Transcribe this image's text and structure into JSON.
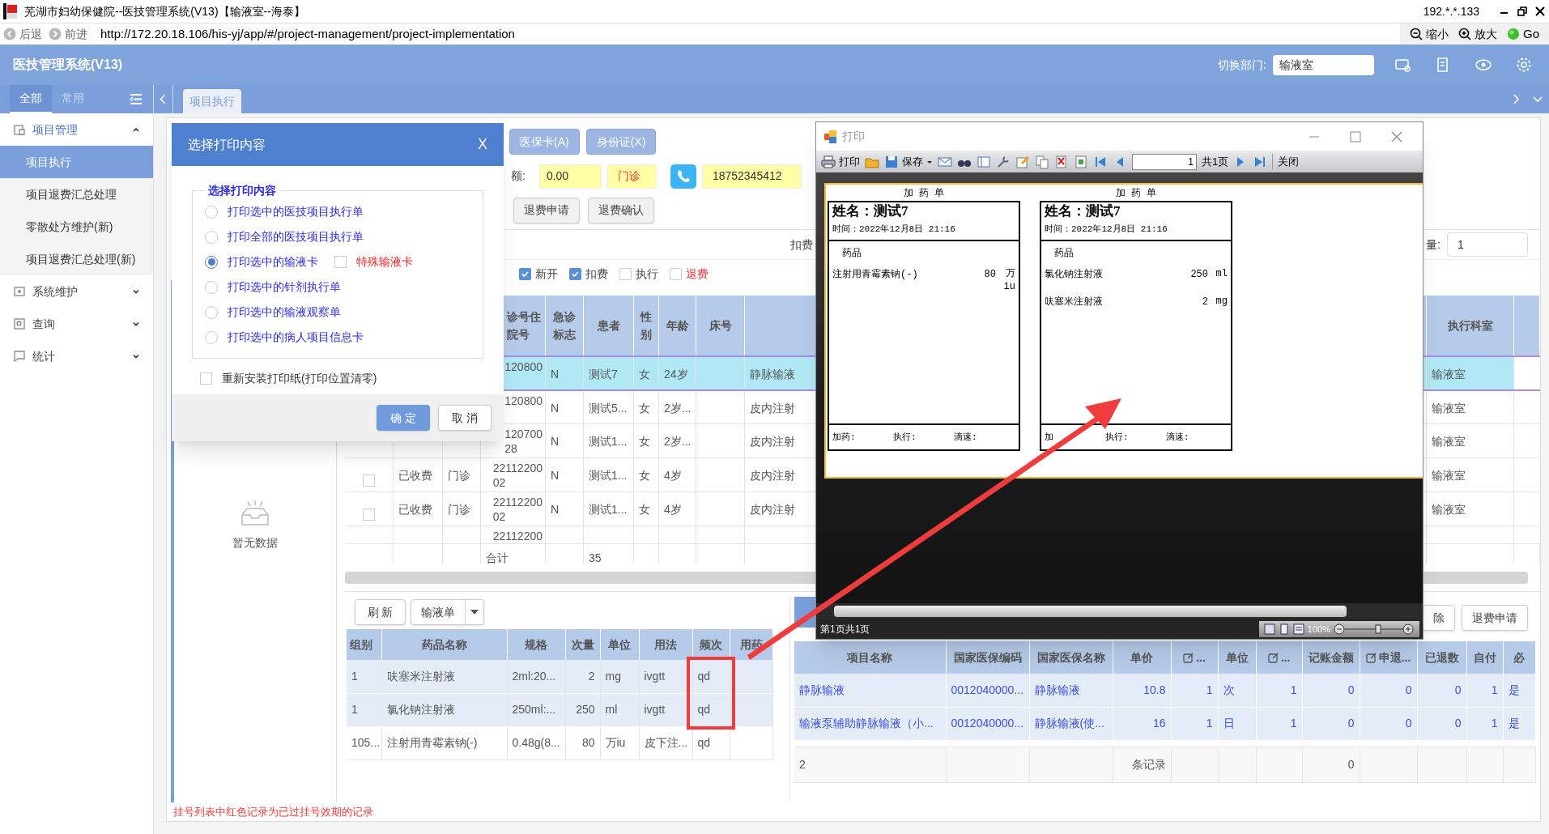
{
  "title_bar": {
    "title": "芜湖市妇幼保健院--医技管理系统(V13)【输液室--海泰】",
    "ip": "192.*.*.133"
  },
  "address_bar": {
    "back": "后退",
    "forward": "前进",
    "url": "http://172.20.18.106/his-yj/app/#/project-management/project-implementation",
    "zoom_out": "缩小",
    "zoom_in": "放大",
    "go": "Go"
  },
  "header": {
    "app_name": "医技管理系统(V13)",
    "dept_label": "切换部门:",
    "dept_value": "输液室"
  },
  "sidebar": {
    "tabs": [
      {
        "label": "全部",
        "selected": true
      },
      {
        "label": "常用",
        "selected": false
      }
    ],
    "items": [
      {
        "label": "项目管理",
        "expanded": true,
        "children": [
          {
            "label": "项目执行",
            "selected": true
          },
          {
            "label": "项目退费汇总处理",
            "selected": false
          },
          {
            "label": "零散处方维护(新)",
            "selected": false
          },
          {
            "label": "项目退费汇总处理(新)",
            "selected": false
          }
        ]
      },
      {
        "label": "系统维护",
        "expanded": false
      },
      {
        "label": "查询",
        "expanded": false
      },
      {
        "label": "统计",
        "expanded": false
      }
    ]
  },
  "tabs": [
    {
      "label": "项目执行",
      "selected": true
    }
  ],
  "toolbar": {
    "card_buttons": [
      "医保卡(A)",
      "身份证(X)"
    ],
    "balance_label": "额:",
    "balance": "0.00",
    "visit_type": "门诊",
    "phone": "18752345412",
    "refund_buttons": [
      "退费申请",
      "退费确认"
    ],
    "deduct_label": "扣费",
    "qty_label": "量:",
    "qty": "1",
    "filters": [
      {
        "label": "新开",
        "checked": true,
        "kind": "normal"
      },
      {
        "label": "扣费",
        "checked": true,
        "kind": "normal"
      },
      {
        "label": "执行",
        "checked": false,
        "kind": "normal"
      },
      {
        "label": "退费",
        "checked": false,
        "kind": "warning"
      }
    ]
  },
  "patient_table": {
    "columns": {
      "visit_no": "诊号住院号",
      "emergency": "急诊标志",
      "patient": "患者",
      "sex": "性别",
      "age": "年龄",
      "bed": "床号",
      "dept": "执行科室"
    },
    "rows": [
      {
        "visit_no": "120800",
        "emergency": "N",
        "patient": "测试7",
        "sex": "女",
        "age": "24岁",
        "diagnosis": "静脉输液",
        "dept": "输液室",
        "selected": true
      },
      {
        "visit_no": "120800",
        "emergency": "N",
        "patient": "测试5...",
        "sex": "女",
        "age": "2岁...",
        "diagnosis": "皮内注射",
        "dept": "输液室",
        "selected": false
      },
      {
        "visit_no": "120700\n28",
        "emergency": "N",
        "patient": "测试1...",
        "sex": "女",
        "age": "2岁...",
        "diagnosis": "皮内注射",
        "dept": "输液室",
        "selected": false
      },
      {
        "checked": false,
        "status": "已收费",
        "type": "门诊",
        "visit_no": "22112200\n02",
        "emergency": "N",
        "patient": "测试1...",
        "sex": "女",
        "age": "4岁",
        "diagnosis": "皮内注射",
        "dept": "输液室",
        "selected": false
      },
      {
        "checked": false,
        "status": "已收费",
        "type": "门诊",
        "visit_no": "22112200\n02",
        "emergency": "N",
        "patient": "测试1...",
        "sex": "女",
        "age": "4岁",
        "diagnosis": "皮内注射",
        "dept": "输液室",
        "selected": false
      },
      {
        "visit_no": "22112200",
        "selected": false
      }
    ],
    "footer": {
      "label": "合计",
      "count": "35"
    }
  },
  "patient_list": {
    "empty_text": "暂无数据"
  },
  "drug_panel": {
    "buttons": [
      "刷 新",
      "输液单"
    ],
    "columns": [
      "组别",
      "药品名称",
      "规格",
      "次量",
      "单位",
      "用法",
      "频次",
      "用药"
    ],
    "rows": [
      [
        "1",
        "呋塞米注射液",
        "2ml:20...",
        "2",
        "mg",
        "ivgtt",
        "qd"
      ],
      [
        "1",
        "氯化钠注射液",
        "250ml:...",
        "250",
        "ml",
        "ivgtt",
        "qd"
      ],
      [
        "105...",
        "注射用青霉素钠(-)",
        "0.48g(8...",
        "80",
        "万iu",
        "皮下注...",
        "qd"
      ]
    ]
  },
  "item_panel": {
    "buttons": [
      "除",
      "退费申请"
    ],
    "columns": [
      {
        "label": "项目名称",
        "editable": false
      },
      {
        "label": "国家医保编码",
        "editable": false
      },
      {
        "label": "国家医保名称",
        "editable": false
      },
      {
        "label": "单价",
        "editable": false
      },
      {
        "label": "...",
        "editable": true
      },
      {
        "label": "单位",
        "editable": false
      },
      {
        "label": "...",
        "editable": true
      },
      {
        "label": "记账金额",
        "editable": false
      },
      {
        "label": "申退...",
        "editable": true
      },
      {
        "label": "已退数",
        "editable": false
      },
      {
        "label": "自付",
        "editable": false
      },
      {
        "label": "必",
        "editable": false
      }
    ],
    "rows": [
      [
        "静脉输液",
        "0012040000...",
        "静脉输液",
        "10.8",
        "1",
        "次",
        "1",
        "0",
        "0",
        "0",
        "1",
        "是"
      ],
      [
        "输液泵辅助静脉输液（小...",
        "0012040000...",
        "静脉输液(使...",
        "16",
        "1",
        "日",
        "1",
        "0",
        "0",
        "0",
        "1",
        "是"
      ]
    ],
    "footer": {
      "count": "2",
      "label": "条记录",
      "amount": "0"
    }
  },
  "notice": "挂号列表中红色记录为已过挂号效期的记录",
  "print_dialog": {
    "title": "选择打印内容",
    "close": "X",
    "group_label": "选择打印内容",
    "options": [
      {
        "label": "打印选中的医技项目执行单",
        "selected": false
      },
      {
        "label": "打印全部的医技项目执行单",
        "selected": false
      },
      {
        "label": "打印选中的输液卡",
        "selected": true,
        "extra": {
          "label": "特殊输液卡",
          "checked": false
        }
      },
      {
        "label": "打印选中的针剂执行单",
        "selected": false
      },
      {
        "label": "打印选中的输液观察单",
        "selected": false
      },
      {
        "label": "打印选中的病人项目信息卡",
        "selected": false
      }
    ],
    "reset": {
      "label": "重新安装打印纸(打印位置清零)",
      "checked": false
    },
    "buttons": [
      {
        "label": "确 定",
        "kind": "primary"
      },
      {
        "label": "取 消",
        "kind": "default"
      }
    ]
  },
  "print_window": {
    "title": "打印",
    "toolbar": {
      "print": "打印",
      "save": "保存",
      "page": "1",
      "total": "共1页",
      "close": "关闭"
    },
    "cards": [
      {
        "heading": "加 药 单",
        "name": "姓名：测试7",
        "time": "时间：2022年12月8日 21:16",
        "section": "药品",
        "drugs": [
          {
            "name": "注射用青霉素钠(-)",
            "dose": "80",
            "unit": "万 iu"
          }
        ],
        "footer": [
          "加药:",
          "执行:",
          "滴速:"
        ]
      },
      {
        "heading": "加 药 单",
        "name": "姓名：测试7",
        "time": "时间：2022年12月8日 21:16",
        "section": "药品",
        "drugs": [
          {
            "name": "氯化钠注射液",
            "dose": "250",
            "unit": "ml"
          },
          {
            "name": "呋塞米注射液",
            "dose": "2",
            "unit": "mg"
          }
        ],
        "footer": [
          "加",
          "执行:",
          "滴速:"
        ]
      }
    ],
    "status": "第1页共1页",
    "zoom": "100%"
  }
}
